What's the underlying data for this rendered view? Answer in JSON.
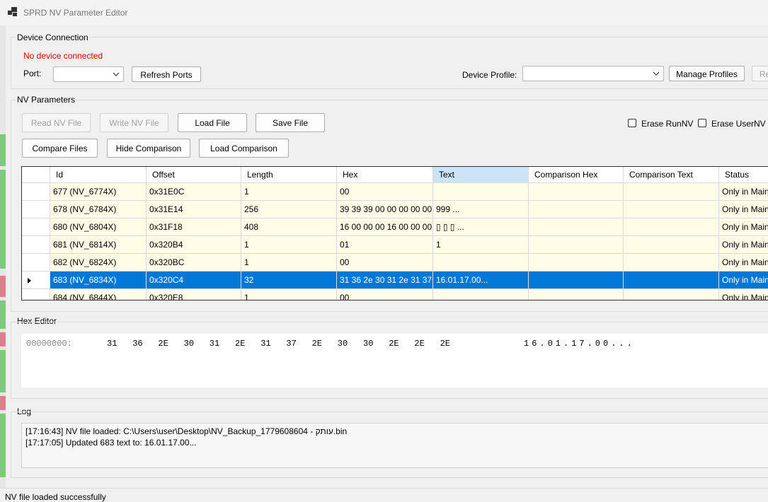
{
  "window": {
    "title": "SPRD NV Parameter Editor",
    "icon": "app-grid-icon"
  },
  "device_connection": {
    "label": "Device Connection",
    "status": "No device connected",
    "status_color": "#e00000",
    "port_label": "Port:",
    "port_value": "",
    "refresh_ports": "Refresh Ports",
    "device_profile_label": "Device Profile:",
    "device_profile_value": "",
    "manage_profiles": "Manage Profiles",
    "cut_button": "Re"
  },
  "nv_parameters": {
    "label": "NV Parameters",
    "read_nv": "Read NV File",
    "write_nv": "Write NV File",
    "load_file": "Load File",
    "save_file": "Save File",
    "erase_runnv": "Erase RunNV",
    "erase_usernv": "Erase UserNV",
    "compare_files": "Compare Files",
    "hide_comparison": "Hide Comparison",
    "load_comparison": "Load Comparison"
  },
  "grid": {
    "columns": [
      "Id",
      "Offset",
      "Length",
      "Hex",
      "Text",
      "Comparison Hex",
      "Comparison Text",
      "Status"
    ],
    "rows": [
      {
        "id": "677 (NV_6774X)",
        "offset": "0x31E0C",
        "length": "1",
        "hex": "00",
        "text": "",
        "chex": "",
        "ctext": "",
        "status": "Only in Main"
      },
      {
        "id": "678 (NV_6784X)",
        "offset": "0x31E14",
        "length": "256",
        "hex": "39 39 39 00 00 00 00 00...",
        "text": "999                ...",
        "chex": "",
        "ctext": "",
        "status": "Only in Main"
      },
      {
        "id": "680 (NV_6804X)",
        "offset": "0x31F18",
        "length": "408",
        "hex": "16 00 00 00 16 00 00 00...",
        "text": "▯     ▯     ▯           ...",
        "chex": "",
        "ctext": "",
        "status": "Only in Main"
      },
      {
        "id": "681 (NV_6814X)",
        "offset": "0x320B4",
        "length": "1",
        "hex": "01",
        "text": "1",
        "chex": "",
        "ctext": "",
        "status": "Only in Main"
      },
      {
        "id": "682 (NV_6824X)",
        "offset": "0x320BC",
        "length": "1",
        "hex": "00",
        "text": "",
        "chex": "",
        "ctext": "",
        "status": "Only in Main"
      },
      {
        "id": "683 (NV_6834X)",
        "offset": "0x320C4",
        "length": "32",
        "hex": "31 36 2e 30 31 2e 31 37...",
        "text": "16.01.17.00...",
        "chex": "",
        "ctext": "",
        "status": "Only in Main",
        "selected": true
      },
      {
        "id": "684 (NV_6844X)",
        "offset": "0x320E8",
        "length": "1",
        "hex": "00",
        "text": "",
        "chex": "",
        "ctext": "",
        "status": "Only in Main"
      }
    ]
  },
  "hex_editor": {
    "label": "Hex Editor",
    "address": "00000000:",
    "bytes": [
      "31",
      "36",
      "2E",
      "30",
      "31",
      "2E",
      "31",
      "37",
      "2E",
      "30",
      "30",
      "2E",
      "2E",
      "2E"
    ],
    "ascii": "16.01.17.00..."
  },
  "log": {
    "label": "Log",
    "lines": [
      "[17:16:43] NV file loaded: C:\\Users\\user\\Desktop\\NV_Backup_1779608604 - עותק.bin",
      "[17:17:05] Updated 683 text to: 16.01.17.00..."
    ]
  },
  "status_bar": {
    "text": "NV file loaded successfully"
  }
}
